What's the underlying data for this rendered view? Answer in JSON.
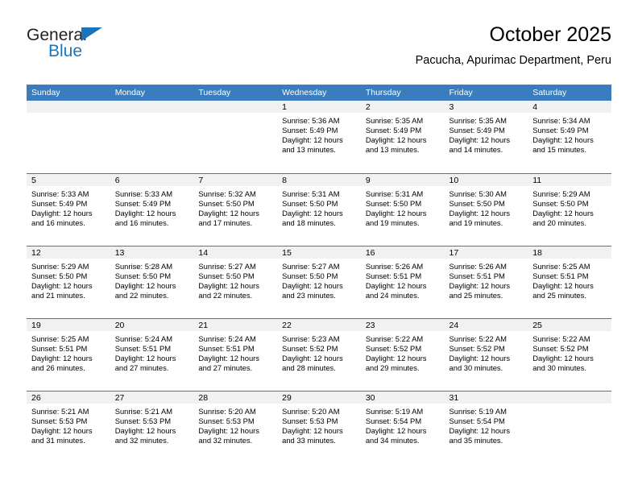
{
  "brand": {
    "name_part1": "General",
    "name_part2": "Blue",
    "accent_color": "#1b75bc",
    "triangle_icon": "brand-triangle-icon"
  },
  "header": {
    "title": "October 2025",
    "subtitle": "Pacucha, Apurimac Department, Peru"
  },
  "colors": {
    "header_blue": "#3a7cbe",
    "daynum_gray": "#f1f1f1",
    "text": "#000000"
  },
  "weekday_headers": [
    "Sunday",
    "Monday",
    "Tuesday",
    "Wednesday",
    "Thursday",
    "Friday",
    "Saturday"
  ],
  "weeks": [
    [
      {
        "day": "",
        "lines": []
      },
      {
        "day": "",
        "lines": []
      },
      {
        "day": "",
        "lines": []
      },
      {
        "day": "1",
        "lines": [
          "Sunrise: 5:36 AM",
          "Sunset: 5:49 PM",
          "Daylight: 12 hours",
          "and 13 minutes."
        ]
      },
      {
        "day": "2",
        "lines": [
          "Sunrise: 5:35 AM",
          "Sunset: 5:49 PM",
          "Daylight: 12 hours",
          "and 13 minutes."
        ]
      },
      {
        "day": "3",
        "lines": [
          "Sunrise: 5:35 AM",
          "Sunset: 5:49 PM",
          "Daylight: 12 hours",
          "and 14 minutes."
        ]
      },
      {
        "day": "4",
        "lines": [
          "Sunrise: 5:34 AM",
          "Sunset: 5:49 PM",
          "Daylight: 12 hours",
          "and 15 minutes."
        ]
      }
    ],
    [
      {
        "day": "5",
        "lines": [
          "Sunrise: 5:33 AM",
          "Sunset: 5:49 PM",
          "Daylight: 12 hours",
          "and 16 minutes."
        ]
      },
      {
        "day": "6",
        "lines": [
          "Sunrise: 5:33 AM",
          "Sunset: 5:49 PM",
          "Daylight: 12 hours",
          "and 16 minutes."
        ]
      },
      {
        "day": "7",
        "lines": [
          "Sunrise: 5:32 AM",
          "Sunset: 5:50 PM",
          "Daylight: 12 hours",
          "and 17 minutes."
        ]
      },
      {
        "day": "8",
        "lines": [
          "Sunrise: 5:31 AM",
          "Sunset: 5:50 PM",
          "Daylight: 12 hours",
          "and 18 minutes."
        ]
      },
      {
        "day": "9",
        "lines": [
          "Sunrise: 5:31 AM",
          "Sunset: 5:50 PM",
          "Daylight: 12 hours",
          "and 19 minutes."
        ]
      },
      {
        "day": "10",
        "lines": [
          "Sunrise: 5:30 AM",
          "Sunset: 5:50 PM",
          "Daylight: 12 hours",
          "and 19 minutes."
        ]
      },
      {
        "day": "11",
        "lines": [
          "Sunrise: 5:29 AM",
          "Sunset: 5:50 PM",
          "Daylight: 12 hours",
          "and 20 minutes."
        ]
      }
    ],
    [
      {
        "day": "12",
        "lines": [
          "Sunrise: 5:29 AM",
          "Sunset: 5:50 PM",
          "Daylight: 12 hours",
          "and 21 minutes."
        ]
      },
      {
        "day": "13",
        "lines": [
          "Sunrise: 5:28 AM",
          "Sunset: 5:50 PM",
          "Daylight: 12 hours",
          "and 22 minutes."
        ]
      },
      {
        "day": "14",
        "lines": [
          "Sunrise: 5:27 AM",
          "Sunset: 5:50 PM",
          "Daylight: 12 hours",
          "and 22 minutes."
        ]
      },
      {
        "day": "15",
        "lines": [
          "Sunrise: 5:27 AM",
          "Sunset: 5:50 PM",
          "Daylight: 12 hours",
          "and 23 minutes."
        ]
      },
      {
        "day": "16",
        "lines": [
          "Sunrise: 5:26 AM",
          "Sunset: 5:51 PM",
          "Daylight: 12 hours",
          "and 24 minutes."
        ]
      },
      {
        "day": "17",
        "lines": [
          "Sunrise: 5:26 AM",
          "Sunset: 5:51 PM",
          "Daylight: 12 hours",
          "and 25 minutes."
        ]
      },
      {
        "day": "18",
        "lines": [
          "Sunrise: 5:25 AM",
          "Sunset: 5:51 PM",
          "Daylight: 12 hours",
          "and 25 minutes."
        ]
      }
    ],
    [
      {
        "day": "19",
        "lines": [
          "Sunrise: 5:25 AM",
          "Sunset: 5:51 PM",
          "Daylight: 12 hours",
          "and 26 minutes."
        ]
      },
      {
        "day": "20",
        "lines": [
          "Sunrise: 5:24 AM",
          "Sunset: 5:51 PM",
          "Daylight: 12 hours",
          "and 27 minutes."
        ]
      },
      {
        "day": "21",
        "lines": [
          "Sunrise: 5:24 AM",
          "Sunset: 5:51 PM",
          "Daylight: 12 hours",
          "and 27 minutes."
        ]
      },
      {
        "day": "22",
        "lines": [
          "Sunrise: 5:23 AM",
          "Sunset: 5:52 PM",
          "Daylight: 12 hours",
          "and 28 minutes."
        ]
      },
      {
        "day": "23",
        "lines": [
          "Sunrise: 5:22 AM",
          "Sunset: 5:52 PM",
          "Daylight: 12 hours",
          "and 29 minutes."
        ]
      },
      {
        "day": "24",
        "lines": [
          "Sunrise: 5:22 AM",
          "Sunset: 5:52 PM",
          "Daylight: 12 hours",
          "and 30 minutes."
        ]
      },
      {
        "day": "25",
        "lines": [
          "Sunrise: 5:22 AM",
          "Sunset: 5:52 PM",
          "Daylight: 12 hours",
          "and 30 minutes."
        ]
      }
    ],
    [
      {
        "day": "26",
        "lines": [
          "Sunrise: 5:21 AM",
          "Sunset: 5:53 PM",
          "Daylight: 12 hours",
          "and 31 minutes."
        ]
      },
      {
        "day": "27",
        "lines": [
          "Sunrise: 5:21 AM",
          "Sunset: 5:53 PM",
          "Daylight: 12 hours",
          "and 32 minutes."
        ]
      },
      {
        "day": "28",
        "lines": [
          "Sunrise: 5:20 AM",
          "Sunset: 5:53 PM",
          "Daylight: 12 hours",
          "and 32 minutes."
        ]
      },
      {
        "day": "29",
        "lines": [
          "Sunrise: 5:20 AM",
          "Sunset: 5:53 PM",
          "Daylight: 12 hours",
          "and 33 minutes."
        ]
      },
      {
        "day": "30",
        "lines": [
          "Sunrise: 5:19 AM",
          "Sunset: 5:54 PM",
          "Daylight: 12 hours",
          "and 34 minutes."
        ]
      },
      {
        "day": "31",
        "lines": [
          "Sunrise: 5:19 AM",
          "Sunset: 5:54 PM",
          "Daylight: 12 hours",
          "and 35 minutes."
        ]
      },
      {
        "day": "",
        "lines": []
      }
    ]
  ]
}
